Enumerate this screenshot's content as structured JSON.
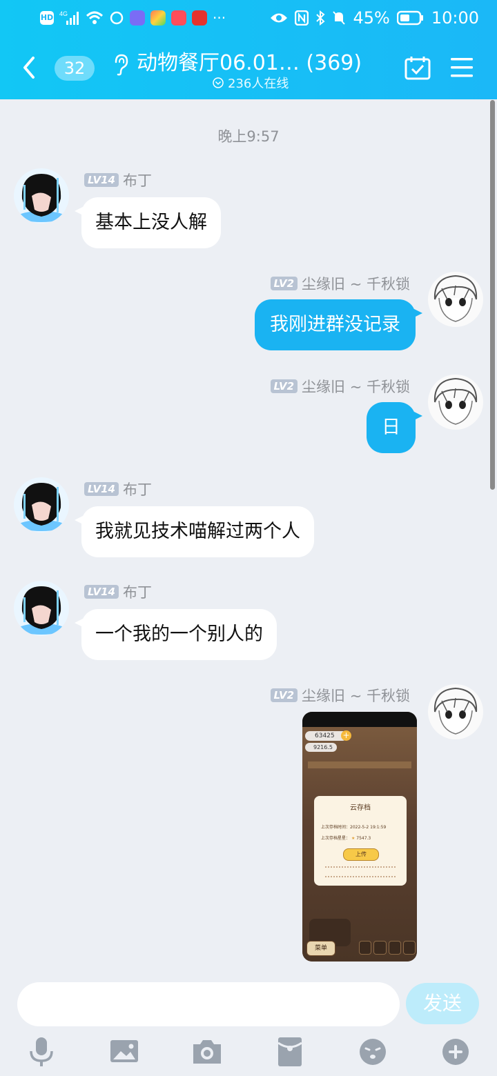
{
  "status_bar": {
    "battery": "45%",
    "time": "10:00"
  },
  "header": {
    "unread_count": "32",
    "title": "动物餐厅06.01… (369)",
    "online": "236人在线"
  },
  "chat": {
    "time_divider": "晚上9:57",
    "messages": [
      {
        "side": "left",
        "level": "LV14",
        "name": "布丁",
        "text": "基本上没人解"
      },
      {
        "side": "right",
        "level": "LV2",
        "name": "尘缘旧 ~ 千秋锁",
        "text": "我刚进群没记录"
      },
      {
        "side": "right",
        "level": "LV2",
        "name": "尘缘旧 ~ 千秋锁",
        "text": "日"
      },
      {
        "side": "left",
        "level": "LV14",
        "name": "布丁",
        "text": "我就见技术喵解过两个人"
      },
      {
        "side": "left",
        "level": "LV14",
        "name": "布丁",
        "text": "一个我的一个别人的"
      },
      {
        "side": "right",
        "level": "LV2",
        "name": "尘缘旧 ~ 千秋锁",
        "text": ""
      }
    ],
    "image_message": {
      "coins": "63425",
      "stars": "9216.5",
      "dialog_title": "云存档",
      "last_save_label": "上次存档时间：2022-5-2 19:1:59",
      "last_stars_label": "上次存档星星：",
      "last_stars_value": "7547.3",
      "upload_button": "上传",
      "menu_label": "菜单"
    }
  },
  "composer": {
    "send_label": "发送"
  },
  "colors": {
    "header": "#1bb8f7",
    "bubble_self": "#1ab3f2",
    "background": "#eceff4"
  }
}
